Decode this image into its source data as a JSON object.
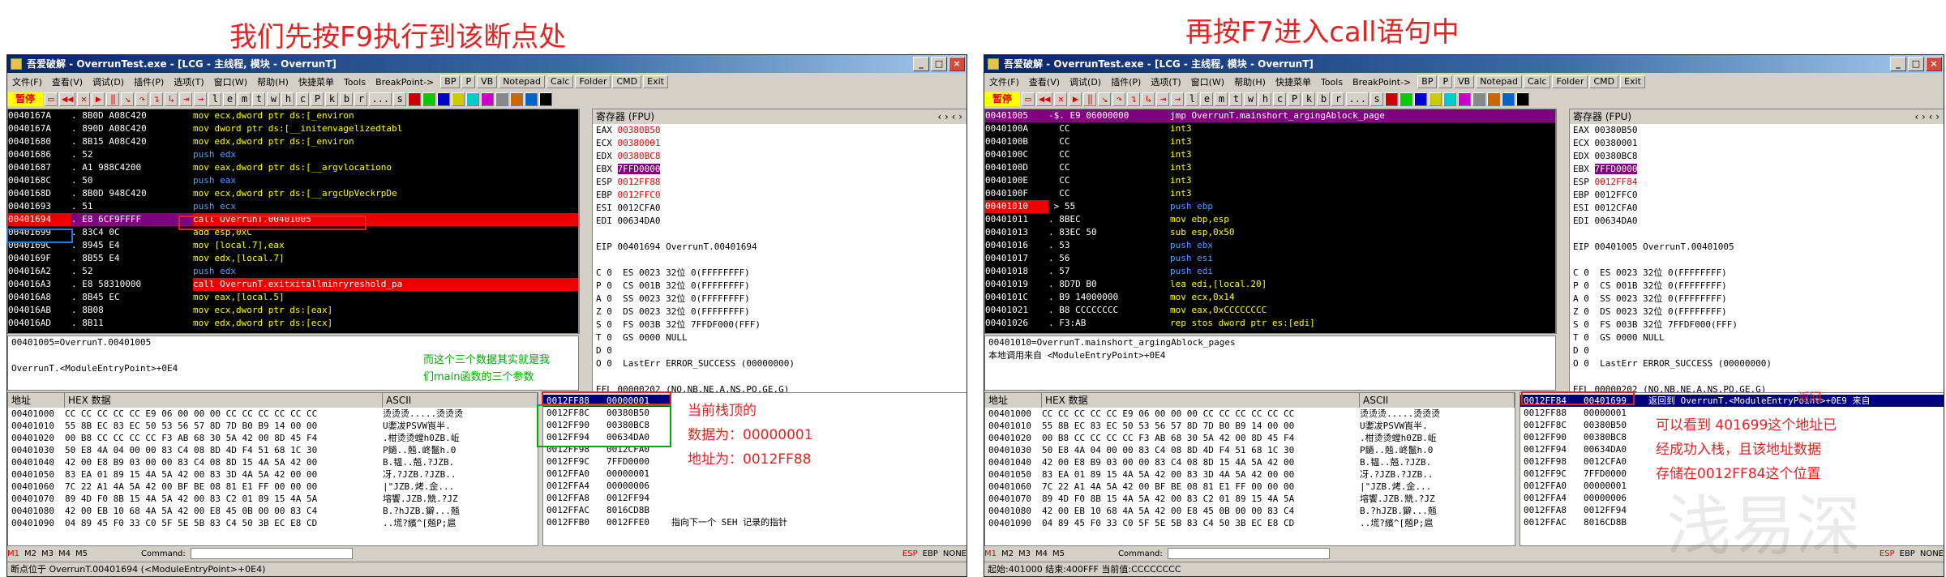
{
  "captions": {
    "left": "我们先按F9执行到该断点处",
    "right": "再按F7进入call语句中"
  },
  "window": {
    "title": "吾爱破解 - OverrunTest.exe - [LCG - 主线程, 模块 - OverrunT]",
    "menu": [
      "文件(F)",
      "查看(V)",
      "调试(D)",
      "插件(P)",
      "选项(T)",
      "窗口(W)",
      "帮助(H)",
      "快捷菜单",
      "Tools",
      "BreakPoint->"
    ],
    "menu_buttons": [
      "BP",
      "P",
      "VB",
      "Notepad",
      "Calc",
      "Folder",
      "CMD",
      "Exit"
    ],
    "pause": "暂停",
    "letter_buttons": [
      "l",
      "e",
      "m",
      "t",
      "w",
      "h",
      "c",
      "P",
      "k",
      "b",
      "r",
      "...",
      "s"
    ],
    "reg_title": "寄存器 (FPU)",
    "dump_addr_header": "地址",
    "dump_hex_header": "HEX 数据",
    "dump_ascii_header": "ASCII",
    "command_label": "Command:",
    "tabs": [
      "M1",
      "M2",
      "M3",
      "M4",
      "M5"
    ],
    "bottom_flags": [
      "ESP",
      "EBP",
      "NONE"
    ]
  },
  "left": {
    "cpu_rows": [
      {
        "addr": "0040167A",
        "hex": ". 8B0D A08C420",
        "asm": "mov ecx,dword ptr ds:[_environ",
        "cls": "yellow"
      },
      {
        "addr": "0040167A",
        "hex": ". 890D A08C420",
        "asm": "mov dword ptr ds:[__initenvagelizedtabl",
        "cls": "yellow"
      },
      {
        "addr": "00401680",
        "hex": ". 8B15 A08C420",
        "asm": "mov edx,dword ptr ds:[_environ",
        "cls": "yellow"
      },
      {
        "addr": "00401686",
        "hex": ". 52",
        "asm": "push edx",
        "cls": "push"
      },
      {
        "addr": "00401687",
        "hex": ". A1 988C4200",
        "asm": "mov eax,dword ptr ds:[__argvlocationo",
        "cls": "yellow"
      },
      {
        "addr": "0040168C",
        "hex": ". 50",
        "asm": "push eax",
        "cls": "push"
      },
      {
        "addr": "0040168D",
        "hex": ". 8B0D 948C420",
        "asm": "mov ecx,dword ptr ds:[__argcUpVeckrpDe",
        "cls": "yellow"
      },
      {
        "addr": "00401693",
        "hex": ". 51",
        "asm": "push ecx",
        "cls": "push"
      },
      {
        "addr": "00401694",
        "hex": ". E8 6CF9FFFF",
        "asm": "call OverrunT.00401005",
        "cls": "call"
      },
      {
        "addr": "00401699",
        "hex": ". 83C4 0C",
        "asm": "add esp,0xC",
        "cls": "yellow"
      },
      {
        "addr": "0040169C",
        "hex": ". 8945 E4",
        "asm": "mov [local.7],eax",
        "cls": "yellow"
      },
      {
        "addr": "0040169F",
        "hex": ". 8B55 E4",
        "asm": "mov edx,[local.7]",
        "cls": "yellow"
      },
      {
        "addr": "004016A2",
        "hex": ". 52",
        "asm": "push edx",
        "cls": "push"
      },
      {
        "addr": "004016A3",
        "hex": ". E8 58310000",
        "asm": "call OverrunT.exitxitallminryreshold_pa",
        "cls": "call"
      },
      {
        "addr": "004016A8",
        "hex": ". 8B45 EC",
        "asm": "mov eax,[local.5]",
        "cls": "yellow"
      },
      {
        "addr": "004016AB",
        "hex": ". 8B08",
        "asm": "mov ecx,dword ptr ds:[eax]",
        "cls": "yellow"
      },
      {
        "addr": "004016AD",
        "hex": ". 8B11",
        "asm": "mov edx,dword ptr ds:[ecx]",
        "cls": "yellow"
      }
    ],
    "info_lines": [
      "00401005=OverrunT.00401005",
      "",
      "OverrunT.<ModuleEntryPoint>+0E4"
    ],
    "regs": [
      {
        "name": "EAX",
        "val": "00380B50",
        "extra": "",
        "cls": "red"
      },
      {
        "name": "ECX",
        "val": "00380001",
        "extra": "",
        "cls": "red"
      },
      {
        "name": "EDX",
        "val": "00380BC8",
        "extra": "",
        "cls": "red"
      },
      {
        "name": "EBX",
        "val": "7FFD0000",
        "extra": "",
        "cls": "box"
      },
      {
        "name": "ESP",
        "val": "0012FF88",
        "extra": "",
        "cls": "red"
      },
      {
        "name": "EBP",
        "val": "0012FFC0",
        "extra": "",
        "cls": "red"
      },
      {
        "name": "ESI",
        "val": "0012CFA0",
        "extra": "",
        "cls": "plain"
      },
      {
        "name": "EDI",
        "val": "00634DA0",
        "extra": "",
        "cls": "plain"
      }
    ],
    "eip": "EIP 00401694 OverrunT.00401694",
    "flags": [
      "C 0  ES 0023 32位 0(FFFFFFFF)",
      "P 0  CS 001B 32位 0(FFFFFFFF)",
      "A 0  SS 0023 32位 0(FFFFFFFF)",
      "Z 0  DS 0023 32位 0(FFFFFFFF)",
      "S 0  FS 003B 32位 7FFDF000(FFF)",
      "T 0  GS 0000 NULL",
      "D 0",
      "O 0  LastErr ERROR_SUCCESS (00000000)",
      "",
      "EFL 00000202 (NO,NB,NE,A,NS,PO,GE,G)"
    ],
    "stack_rows": [
      {
        "addr": "0012FF88",
        "val": "00000001",
        "comment": ""
      },
      {
        "addr": "0012FF8C",
        "val": "00380B50",
        "comment": ""
      },
      {
        "addr": "0012FF90",
        "val": "00380BC8",
        "comment": ""
      },
      {
        "addr": "0012FF94",
        "val": "00634DA0",
        "comment": ""
      },
      {
        "addr": "0012FF98",
        "val": "0012CFA0",
        "comment": ""
      },
      {
        "addr": "0012FF9C",
        "val": "7FFD0000",
        "comment": ""
      },
      {
        "addr": "0012FFA0",
        "val": "00000001",
        "comment": ""
      },
      {
        "addr": "0012FFA4",
        "val": "00000006",
        "comment": ""
      },
      {
        "addr": "0012FFA8",
        "val": "0012FF94",
        "comment": ""
      },
      {
        "addr": "0012FFAC",
        "val": "8016CD8B",
        "comment": ""
      },
      {
        "addr": "0012FFB0",
        "val": "0012FFE0",
        "comment": "指向下一个 SEH 记录的指针"
      }
    ],
    "status": "断点位于 OverrunT.00401694 (<ModuleEntryPoint>+0E4)",
    "anno_green": [
      "而这个三个数据其实就是我",
      "们main函数的三个参数"
    ],
    "anno_red": [
      "当前栈顶的",
      "数据为：00000001",
      "地址为：0012FF88"
    ]
  },
  "right": {
    "cpu_rows": [
      {
        "addr": "00401005",
        "hex": "-$. E9 06000000",
        "asm": "jmp OverrunT.mainshort_argingAblock_page",
        "cls": "jmp"
      },
      {
        "addr": "0040100A",
        "hex": "  CC",
        "asm": "int3",
        "cls": "yellow"
      },
      {
        "addr": "0040100B",
        "hex": "  CC",
        "asm": "int3",
        "cls": "yellow"
      },
      {
        "addr": "0040100C",
        "hex": "  CC",
        "asm": "int3",
        "cls": "yellow"
      },
      {
        "addr": "0040100D",
        "hex": "  CC",
        "asm": "int3",
        "cls": "yellow"
      },
      {
        "addr": "0040100E",
        "hex": "  CC",
        "asm": "int3",
        "cls": "yellow"
      },
      {
        "addr": "0040100F",
        "hex": "  CC",
        "asm": "int3",
        "cls": "yellow"
      },
      {
        "addr": "00401010",
        "hex": " > 55",
        "asm": "push ebp",
        "cls": "push"
      },
      {
        "addr": "00401011",
        "hex": ". 8BEC",
        "asm": "mov ebp,esp",
        "cls": "yellow"
      },
      {
        "addr": "00401013",
        "hex": ". 83EC 50",
        "asm": "sub esp,0x50",
        "cls": "yellow"
      },
      {
        "addr": "00401016",
        "hex": ". 53",
        "asm": "push ebx",
        "cls": "push"
      },
      {
        "addr": "00401017",
        "hex": ". 56",
        "asm": "push esi",
        "cls": "push"
      },
      {
        "addr": "00401018",
        "hex": ". 57",
        "asm": "push edi",
        "cls": "push"
      },
      {
        "addr": "00401019",
        "hex": ". 8D7D B0",
        "asm": "lea edi,[local.20]",
        "cls": "yellow"
      },
      {
        "addr": "0040101C",
        "hex": ". B9 14000000",
        "asm": "mov ecx,0x14",
        "cls": "yellow"
      },
      {
        "addr": "00401021",
        "hex": ". B8 CCCCCCCC",
        "asm": "mov eax,0xCCCCCCCC",
        "cls": "yellow"
      },
      {
        "addr": "00401026",
        "hex": ". F3:AB",
        "asm": "rep stos dword ptr es:[edi]",
        "cls": "yellow"
      }
    ],
    "info_lines": [
      "00401010=OverrunT.mainshort_argingAblock_pages",
      "本地调用来自 <ModuleEntryPoint>+0E4"
    ],
    "regs": [
      {
        "name": "EAX",
        "val": "00380B50",
        "extra": "",
        "cls": "plain"
      },
      {
        "name": "ECX",
        "val": "00380001",
        "extra": "",
        "cls": "plain"
      },
      {
        "name": "EDX",
        "val": "00380BC8",
        "extra": "",
        "cls": "plain"
      },
      {
        "name": "EBX",
        "val": "7FFD0000",
        "extra": "",
        "cls": "box"
      },
      {
        "name": "ESP",
        "val": "0012FF84",
        "extra": "",
        "cls": "red"
      },
      {
        "name": "EBP",
        "val": "0012FFC0",
        "extra": "",
        "cls": "plain"
      },
      {
        "name": "ESI",
        "val": "0012CFA0",
        "extra": "",
        "cls": "plain"
      },
      {
        "name": "EDI",
        "val": "00634DA0",
        "extra": "",
        "cls": "plain"
      }
    ],
    "eip": "EIP 00401005 OverrunT.00401005",
    "flags": [
      "C 0  ES 0023 32位 0(FFFFFFFF)",
      "P 0  CS 001B 32位 0(FFFFFFFF)",
      "A 0  SS 0023 32位 0(FFFFFFFF)",
      "Z 0  DS 0023 32位 0(FFFFFFFF)",
      "S 0  FS 003B 32位 7FFDF000(FFF)",
      "T 0  GS 0000 NULL",
      "D 0",
      "O 0  LastErr ERROR_SUCCESS (00000000)",
      "",
      "EFL 00000202 (NO,NB,NE,A,NS,PO,GE,G)"
    ],
    "stack_rows": [
      {
        "addr": "0012FF84",
        "val": "00401699",
        "comment": "返回到 OverrunT.<ModuleEntryPoint>+0E9 来自"
      },
      {
        "addr": "0012FF88",
        "val": "00000001",
        "comment": ""
      },
      {
        "addr": "0012FF8C",
        "val": "00380B50",
        "comment": ""
      },
      {
        "addr": "0012FF90",
        "val": "00380BC8",
        "comment": ""
      },
      {
        "addr": "0012FF94",
        "val": "00634DA0",
        "comment": ""
      },
      {
        "addr": "0012FF98",
        "val": "0012CFA0",
        "comment": ""
      },
      {
        "addr": "0012FF9C",
        "val": "7FFD0000",
        "comment": ""
      },
      {
        "addr": "0012FFA0",
        "val": "00000001",
        "comment": ""
      },
      {
        "addr": "0012FFA4",
        "val": "00000006",
        "comment": ""
      },
      {
        "addr": "0012FFA8",
        "val": "0012FF94",
        "comment": ""
      },
      {
        "addr": "0012FFAC",
        "val": "8016CD8B",
        "comment": ""
      }
    ],
    "status": "起始:401000 结束:400FFF 当前值:CCCCCCCC",
    "anno_red": [
      "可以看到 401699这个地址已",
      "经成功入栈，且该地址数据",
      "存储在0012FF84这个位置"
    ],
    "return_label": "返回",
    "watermark": "浅易深"
  },
  "dump_rows": [
    {
      "addr": "00401000",
      "hex": "CC CC CC CC CC E9 06 00 00 00 CC CC CC CC CC CC",
      "ascii": "烫烫烫.....烫烫烫"
    },
    {
      "addr": "00401010",
      "hex": "55 8B EC 83 EC 50 53 56 57 8D 7D B0 B9 14 00 00",
      "ascii": "U嬱冹PSVW崀半."
    },
    {
      "addr": "00401020",
      "hex": "00 B8 CC CC CC CC F3 AB 68 30 5A 42 00 8D 45 F4",
      "ascii": ".柑烫烫螳h0ZB.岴"
    },
    {
      "addr": "00401030",
      "hex": "50 E8 4A 04 00 00 83 C4 08 8D 4D F4 51 68 1C 30",
      "ascii": "P鐹..兡.峂鬛h.0"
    },
    {
      "addr": "00401040",
      "hex": "42 00 E8 B9 03 00 00 83 C4 08 8D 15 4A 5A 42 00",
      "ascii": "B.韫..兡.?JZB."
    },
    {
      "addr": "00401050",
      "hex": "83 EA 01 89 15 4A 5A 42 00 83 3D 4A 5A 42 00 00",
      "ascii": "冴.?JZB.?JZB.."
    },
    {
      "addr": "00401060",
      "hex": "7C 22 A1 4A 5A 42 00 BF BE 08 81 E1 FF 00 00 00",
      "ascii": "|\"JZB.烤.佱..."
    },
    {
      "addr": "00401070",
      "hex": "89 4D F0 8B 15 4A 5A 42 00 83 C2 01 89 15 4A 5A",
      "ascii": "塎饗.JZB.兟.?JZ"
    },
    {
      "addr": "00401080",
      "hex": "42 00 EB 10 68 4A 5A 42 00 E8 45 0B 00 00 83 C4",
      "ascii": "B.?hJZB.鐴...兡"
    },
    {
      "addr": "00401090",
      "hex": "04 89 45 F0 33 C0 5F 5E 5B 83 C4 50 3B EC E8 CD",
      "ascii": "..塃?繽^[兡P;扈"
    }
  ]
}
